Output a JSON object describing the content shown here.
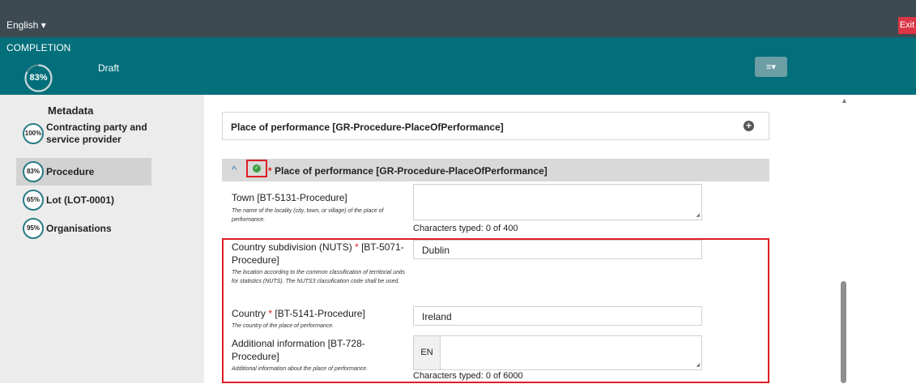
{
  "header": {
    "language": "English ▾",
    "exit_label": "Exit"
  },
  "completion": {
    "label": "COMPLETION",
    "percent": "83%",
    "status": "Draft",
    "settings_icon": "≡▾"
  },
  "sidebar": {
    "title": "Metadata",
    "items": [
      {
        "badge": "100%",
        "label": "Contracting party and service provider"
      },
      {
        "badge": "83%",
        "label": "Procedure"
      },
      {
        "badge": "65%",
        "label": "Lot (LOT-0001)"
      },
      {
        "badge": "95%",
        "label": "Organisations"
      }
    ]
  },
  "panels": {
    "collapsed_title": "Place of performance  [GR-Procedure-PlaceOfPerformance]",
    "open_title": "Place of performance  [GR-Procedure-PlaceOfPerformance]",
    "req_star": "*"
  },
  "fields": {
    "town": {
      "label": "Town [BT-5131-Procedure]",
      "help": "The name of the locality (city, town, or village) of the place of performance.",
      "counter": "Characters typed: 0 of 400"
    },
    "subdivision": {
      "label_prefix": "Country subdivision (NUTS)",
      "label_suffix": "[BT-5071-Procedure]",
      "help": "The location according to the common classification of territorial units for statistics (NUTS). The NUTS3 classification code shall be used.",
      "value": "Dublin"
    },
    "country": {
      "label_prefix": "Country",
      "label_suffix": "[BT-5141-Procedure]",
      "help": "The country of the place of performance.",
      "value": "Ireland"
    },
    "additional": {
      "label": "Additional information [BT-728-Procedure]",
      "help": "Additional information about the place of performance.",
      "lang": "EN",
      "counter": "Characters typed: 0 of 6000"
    }
  },
  "colors": {
    "topbar": "#3d4a52",
    "completion_bar": "#036f7a",
    "exit": "#dc3545",
    "required": "#dd1e24",
    "ok": "#3c9f44"
  }
}
